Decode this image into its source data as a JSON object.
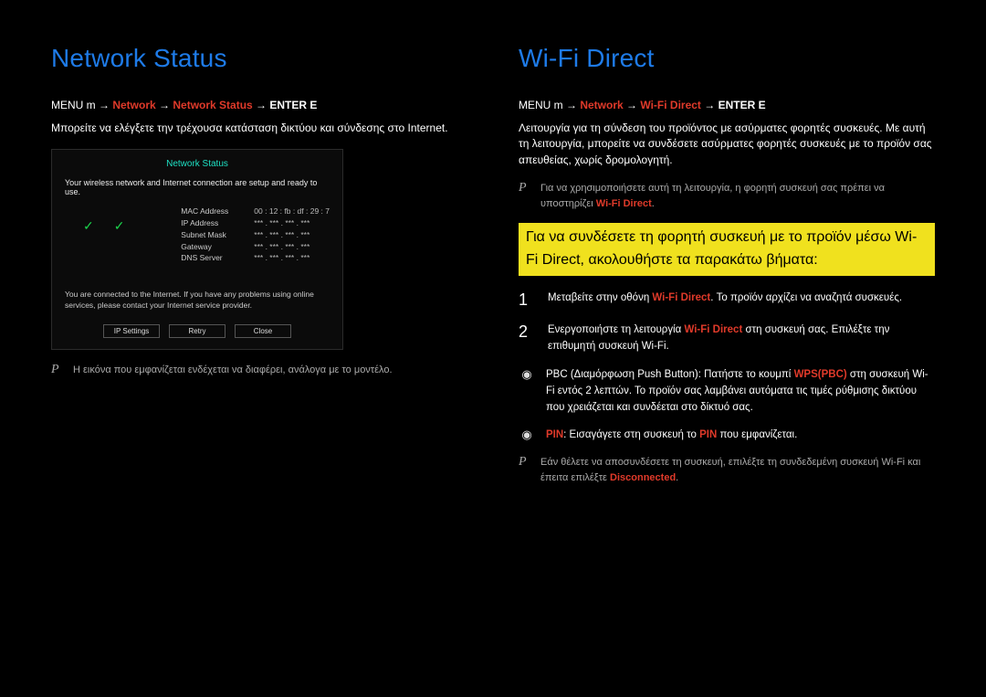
{
  "left": {
    "title": "Network Status",
    "path_prefix": "MENU m → ",
    "path_network": "Network",
    "path_sep": " → ",
    "path_item": "Network Status",
    "path_enter": " → ENTER E",
    "desc": "Μπορείτε να ελέγξετε την τρέχουσα κατάσταση δικτύου και σύνδεσης στο Internet.",
    "box": {
      "title": "Network Status",
      "msg": "Your wireless network and Internet connection are setup and ready to use.",
      "fields": {
        "mac_k": "MAC Address",
        "mac_v": "00 : 12 : fb : df : 29 : 7",
        "ip_k": "IP Address",
        "ip_v": "*** . *** . *** . ***",
        "sm_k": "Subnet Mask",
        "sm_v": "*** . *** . *** . ***",
        "gw_k": "Gateway",
        "gw_v": "*** . *** . *** . ***",
        "dns_k": "DNS Server",
        "dns_v": "*** . *** . *** . ***"
      },
      "msg2": "You are connected to the Internet. If you have any problems using online services, please contact your Internet service provider.",
      "btn1": "IP Settings",
      "btn2": "Retry",
      "btn3": "Close"
    },
    "note": "Η εικόνα που εμφανίζεται ενδέχεται να διαφέρει, ανάλογα με το μοντέλο."
  },
  "right": {
    "title": "Wi-Fi Direct",
    "path_prefix": "MENU m → ",
    "path_network": "Network",
    "path_sep": " → ",
    "path_item": "Wi-Fi Direct",
    "path_enter": " → ENTER E",
    "desc": "Λειτουργία για τη σύνδεση του προϊόντος με ασύρματες φορητές συσκευές. Με αυτή τη λειτουργία, μπορείτε να συνδέσετε ασύρματες φορητές συσκευές με το προϊόν σας απευθείας, χωρίς δρομολογητή.",
    "note1_a": "Για να χρησιμοποιήσετε αυτή τη λειτουργία, η φορητή συσκευή σας πρέπει να υποστηρίζει ",
    "note1_b": "Wi-Fi Direct",
    "note1_c": ".",
    "subhead": "Για να συνδέσετε τη φορητή συσκευή με το προϊόν μέσω Wi-Fi Direct, ακολουθήστε τα παρακάτω βήματα:",
    "step1_num": "1",
    "step1_a": "Μεταβείτε στην οθόνη ",
    "step1_b": "Wi-Fi Direct",
    "step1_c": ". Το προϊόν αρχίζει να αναζητά συσκευές.",
    "step2_num": "2",
    "step2_a": "Ενεργοποιήστε τη λειτουργία ",
    "step2_b": "Wi-Fi Direct",
    "step2_c": " στη συσκευή σας. Επιλέξτε την επιθυμητή συσκευή Wi-Fi.",
    "bullet1_a": "PBC (Διαμόρφωση Push Button): Πατήστε το κουμπί ",
    "bullet1_b": "WPS(PBC)",
    "bullet1_c": " στη συσκευή Wi-Fi εντός 2 λεπτών. Το προϊόν σας λαμβάνει αυτόματα τις τιμές ρύθμισης δικτύου που χρειάζεται και συνδέεται στο δίκτυό σας.",
    "bullet2_a": "PIN",
    "bullet2_b": ": Εισαγάγετε στη συσκευή το ",
    "bullet2_c": "PIN",
    "bullet2_d": " που εμφανίζεται.",
    "note2_a": "Εάν θέλετε να αποσυνδέσετε τη συσκευή, επιλέξτε τη συνδεδεμένη συσκευή Wi-Fi και έπειτα επιλέξτε ",
    "note2_b": "Disconnected",
    "note2_c": "."
  },
  "icons": {
    "check": "✓",
    "bullet": "◉",
    "p": "P"
  }
}
